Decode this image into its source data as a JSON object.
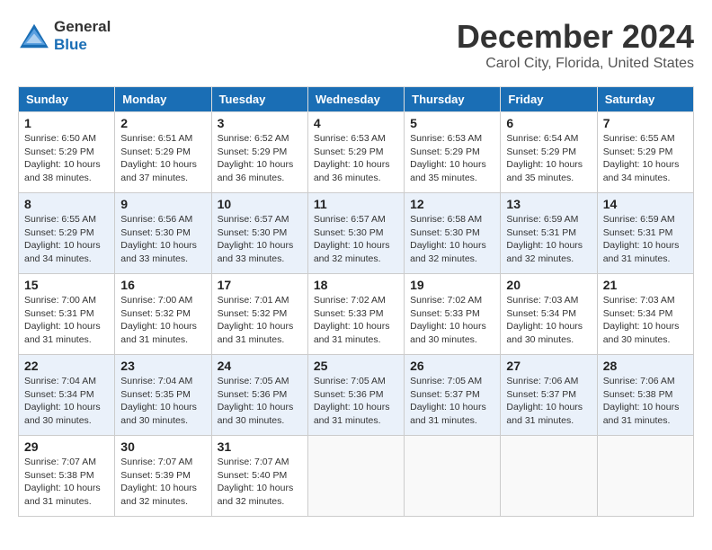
{
  "header": {
    "logo_line1": "General",
    "logo_line2": "Blue",
    "month": "December 2024",
    "location": "Carol City, Florida, United States"
  },
  "days_of_week": [
    "Sunday",
    "Monday",
    "Tuesday",
    "Wednesday",
    "Thursday",
    "Friday",
    "Saturday"
  ],
  "weeks": [
    [
      {
        "day": "1",
        "sunrise": "6:50 AM",
        "sunset": "5:29 PM",
        "daylight": "10 hours and 38 minutes."
      },
      {
        "day": "2",
        "sunrise": "6:51 AM",
        "sunset": "5:29 PM",
        "daylight": "10 hours and 37 minutes."
      },
      {
        "day": "3",
        "sunrise": "6:52 AM",
        "sunset": "5:29 PM",
        "daylight": "10 hours and 36 minutes."
      },
      {
        "day": "4",
        "sunrise": "6:53 AM",
        "sunset": "5:29 PM",
        "daylight": "10 hours and 36 minutes."
      },
      {
        "day": "5",
        "sunrise": "6:53 AM",
        "sunset": "5:29 PM",
        "daylight": "10 hours and 35 minutes."
      },
      {
        "day": "6",
        "sunrise": "6:54 AM",
        "sunset": "5:29 PM",
        "daylight": "10 hours and 35 minutes."
      },
      {
        "day": "7",
        "sunrise": "6:55 AM",
        "sunset": "5:29 PM",
        "daylight": "10 hours and 34 minutes."
      }
    ],
    [
      {
        "day": "8",
        "sunrise": "6:55 AM",
        "sunset": "5:29 PM",
        "daylight": "10 hours and 34 minutes."
      },
      {
        "day": "9",
        "sunrise": "6:56 AM",
        "sunset": "5:30 PM",
        "daylight": "10 hours and 33 minutes."
      },
      {
        "day": "10",
        "sunrise": "6:57 AM",
        "sunset": "5:30 PM",
        "daylight": "10 hours and 33 minutes."
      },
      {
        "day": "11",
        "sunrise": "6:57 AM",
        "sunset": "5:30 PM",
        "daylight": "10 hours and 32 minutes."
      },
      {
        "day": "12",
        "sunrise": "6:58 AM",
        "sunset": "5:30 PM",
        "daylight": "10 hours and 32 minutes."
      },
      {
        "day": "13",
        "sunrise": "6:59 AM",
        "sunset": "5:31 PM",
        "daylight": "10 hours and 32 minutes."
      },
      {
        "day": "14",
        "sunrise": "6:59 AM",
        "sunset": "5:31 PM",
        "daylight": "10 hours and 31 minutes."
      }
    ],
    [
      {
        "day": "15",
        "sunrise": "7:00 AM",
        "sunset": "5:31 PM",
        "daylight": "10 hours and 31 minutes."
      },
      {
        "day": "16",
        "sunrise": "7:00 AM",
        "sunset": "5:32 PM",
        "daylight": "10 hours and 31 minutes."
      },
      {
        "day": "17",
        "sunrise": "7:01 AM",
        "sunset": "5:32 PM",
        "daylight": "10 hours and 31 minutes."
      },
      {
        "day": "18",
        "sunrise": "7:02 AM",
        "sunset": "5:33 PM",
        "daylight": "10 hours and 31 minutes."
      },
      {
        "day": "19",
        "sunrise": "7:02 AM",
        "sunset": "5:33 PM",
        "daylight": "10 hours and 30 minutes."
      },
      {
        "day": "20",
        "sunrise": "7:03 AM",
        "sunset": "5:34 PM",
        "daylight": "10 hours and 30 minutes."
      },
      {
        "day": "21",
        "sunrise": "7:03 AM",
        "sunset": "5:34 PM",
        "daylight": "10 hours and 30 minutes."
      }
    ],
    [
      {
        "day": "22",
        "sunrise": "7:04 AM",
        "sunset": "5:34 PM",
        "daylight": "10 hours and 30 minutes."
      },
      {
        "day": "23",
        "sunrise": "7:04 AM",
        "sunset": "5:35 PM",
        "daylight": "10 hours and 30 minutes."
      },
      {
        "day": "24",
        "sunrise": "7:05 AM",
        "sunset": "5:36 PM",
        "daylight": "10 hours and 30 minutes."
      },
      {
        "day": "25",
        "sunrise": "7:05 AM",
        "sunset": "5:36 PM",
        "daylight": "10 hours and 31 minutes."
      },
      {
        "day": "26",
        "sunrise": "7:05 AM",
        "sunset": "5:37 PM",
        "daylight": "10 hours and 31 minutes."
      },
      {
        "day": "27",
        "sunrise": "7:06 AM",
        "sunset": "5:37 PM",
        "daylight": "10 hours and 31 minutes."
      },
      {
        "day": "28",
        "sunrise": "7:06 AM",
        "sunset": "5:38 PM",
        "daylight": "10 hours and 31 minutes."
      }
    ],
    [
      {
        "day": "29",
        "sunrise": "7:07 AM",
        "sunset": "5:38 PM",
        "daylight": "10 hours and 31 minutes."
      },
      {
        "day": "30",
        "sunrise": "7:07 AM",
        "sunset": "5:39 PM",
        "daylight": "10 hours and 32 minutes."
      },
      {
        "day": "31",
        "sunrise": "7:07 AM",
        "sunset": "5:40 PM",
        "daylight": "10 hours and 32 minutes."
      },
      null,
      null,
      null,
      null
    ]
  ]
}
